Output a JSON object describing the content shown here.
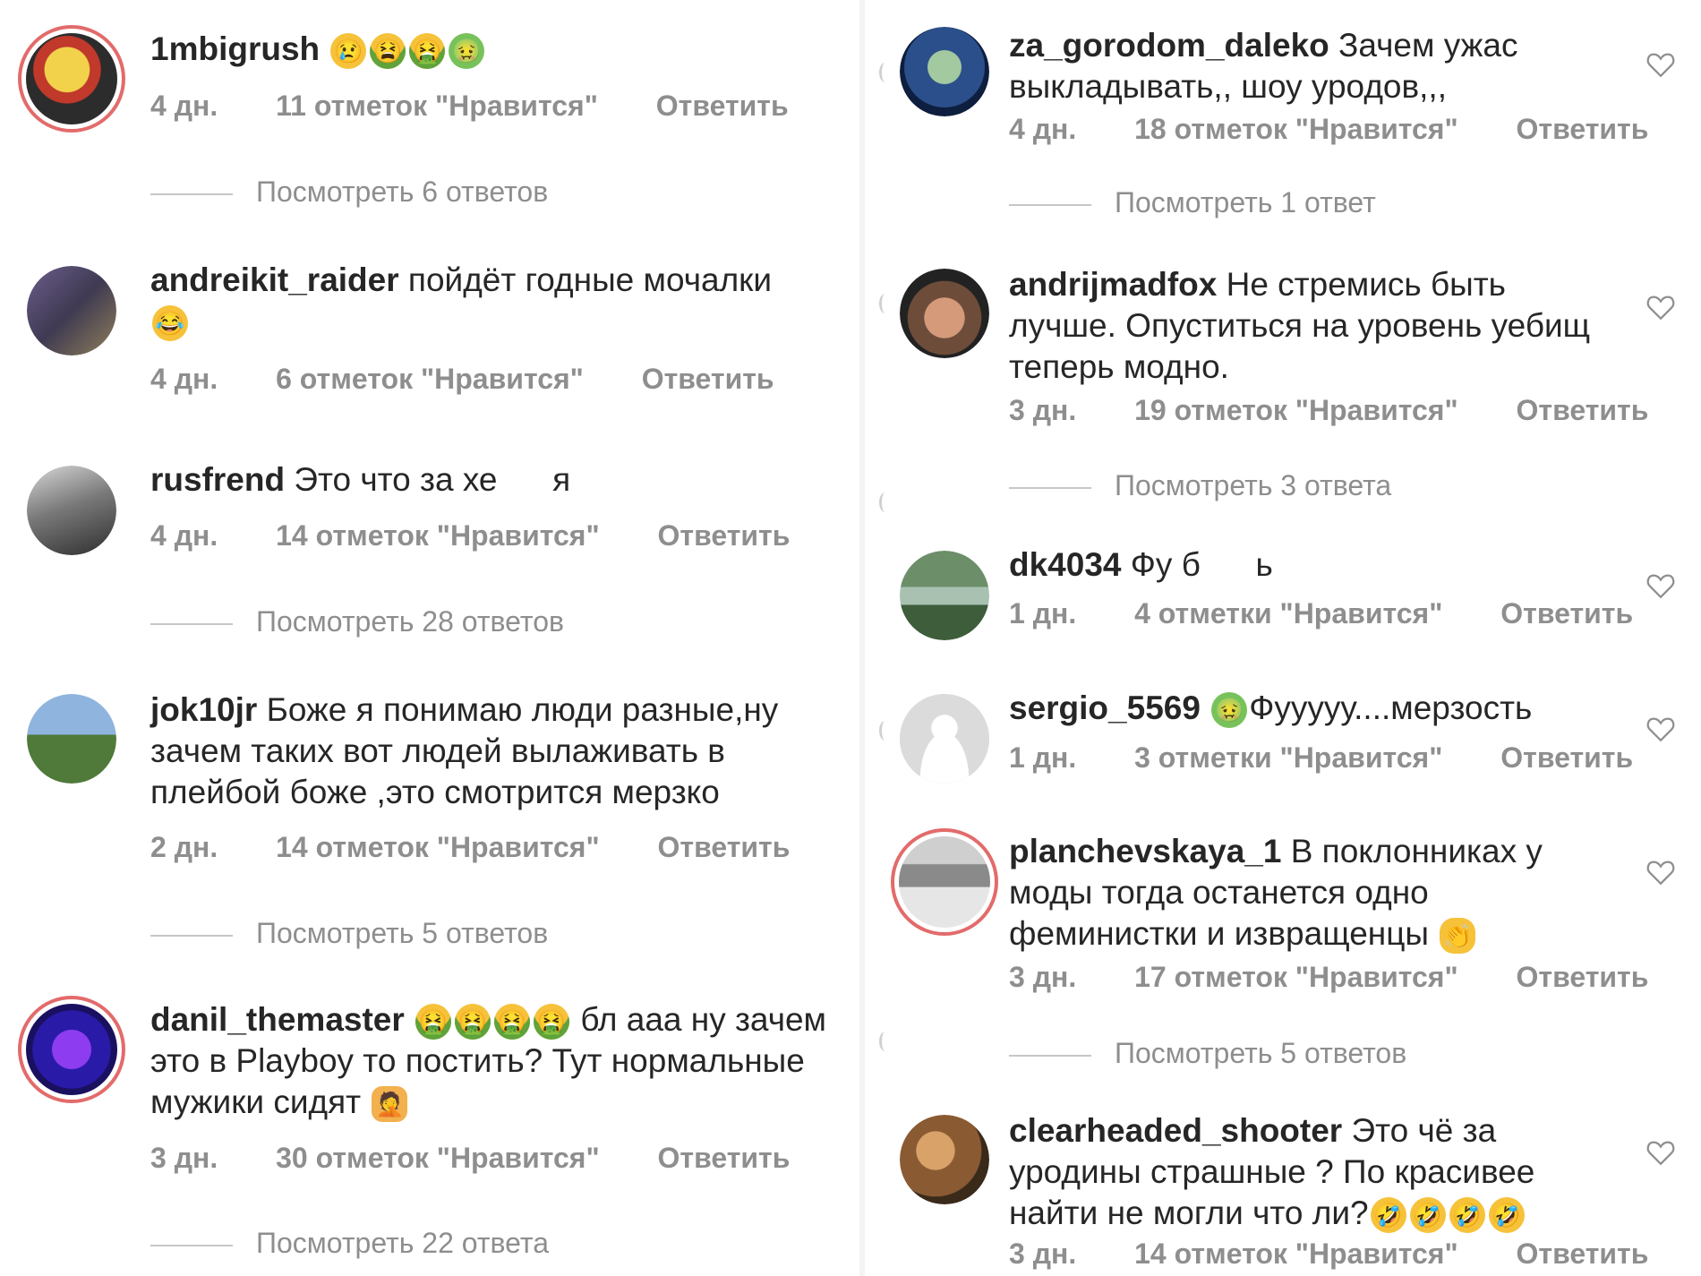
{
  "left": [
    {
      "username": "1mbigrush",
      "text": "",
      "emojis": [
        "crying-face-icon",
        "tired-face-icon",
        "nauseated-face-icon",
        "green-face-icon"
      ],
      "time": "4 дн.",
      "likes": "11 отметок \"Нравится\"",
      "reply": "Ответить",
      "replies": "Посмотреть 6 ответов"
    },
    {
      "username": "andreikit_raider",
      "text": "пойдёт годные мочалки",
      "emojis": [
        "laughing-face-icon"
      ],
      "time": "4 дн.",
      "likes": "6 отметок \"Нравится\"",
      "reply": "Ответить"
    },
    {
      "username": "rusfrend",
      "text": "Это что за хе      я",
      "time": "4 дн.",
      "likes": "14 отметок \"Нравится\"",
      "reply": "Ответить",
      "replies": "Посмотреть 28 ответов"
    },
    {
      "username": "jok10jr",
      "text": "Боже я понимаю люди разные,ну зачем таких вот людей вылаживать в плейбой боже ,это смотрится мерзко",
      "time": "2 дн.",
      "likes": "14 отметок \"Нравится\"",
      "reply": "Ответить",
      "replies": "Посмотреть 5 ответов"
    },
    {
      "username": "danil_themaster",
      "text": "бл        aaa ну зачем это в Playboy то постить? Тут нормальные мужики сидят",
      "time": "3 дн.",
      "likes": "30 отметок \"Нравится\"",
      "reply": "Ответить",
      "replies": "Посмотреть 22 ответа"
    }
  ],
  "right": [
    {
      "username": "za_gorodom_daleko",
      "text": "Зачем ужас выкладывать,, шоу уродов,,,",
      "time": "4 дн.",
      "likes": "18 отметок \"Нравится\"",
      "reply": "Ответить",
      "replies": "Посмотреть 1 ответ"
    },
    {
      "username": "andrijmadfox",
      "text": "Не стремись быть лучше. Опуститься на уровень уебищ теперь модно.",
      "time": "3 дн.",
      "likes": "19 отметок \"Нравится\"",
      "reply": "Ответить",
      "replies": "Посмотреть 3 ответа"
    },
    {
      "username": "dk4034",
      "text": "Фу б      ь",
      "time": "1 дн.",
      "likes": "4 отметки \"Нравится\"",
      "reply": "Ответить"
    },
    {
      "username": "sergio_5569",
      "text": "Фууууу....мерзость",
      "time": "1 дн.",
      "likes": "3 отметки \"Нравится\"",
      "reply": "Ответить"
    },
    {
      "username": "planchevskaya_1",
      "text": "В поклонниках у моды тогда останется одно феминистки и извращенцы",
      "time": "3 дн.",
      "likes": "17 отметок \"Нравится\"",
      "reply": "Ответить",
      "replies": "Посмотреть 5 ответов"
    },
    {
      "username": "clearheaded_shooter",
      "text": "Это чё за уродины страшные ? По красивее найти не могли что ли?",
      "time": "3 дн.",
      "likes": "14 отметок \"Нравится\"",
      "reply": "Ответить"
    }
  ],
  "colors": {
    "text": "#262626",
    "meta": "#8e8e8e",
    "story_ring": "#e36b6b"
  }
}
